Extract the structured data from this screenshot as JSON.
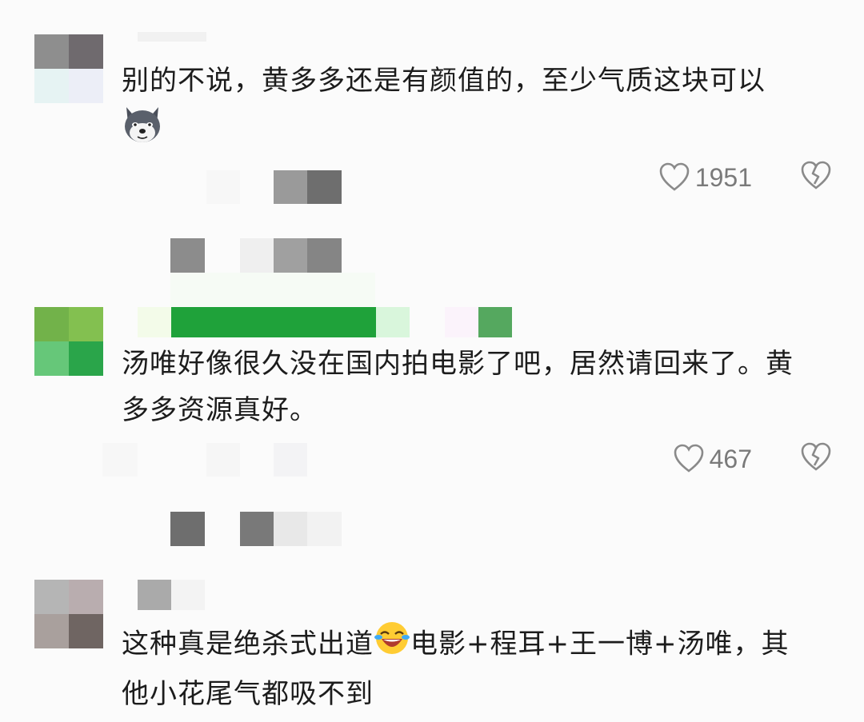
{
  "comments": [
    {
      "text": "别的不说，黄多多还是有颜值的，至少气质这块可以",
      "emoji": "wolf-face",
      "likes": "1951"
    },
    {
      "text_line1": "汤唯好像很久没在国内拍电影了吧，居然请回来了。黄",
      "text_line2": "多多资源真好。",
      "likes": "467"
    },
    {
      "text_part1": "这种真是绝杀式出道",
      "emoji": "laughing-crying-face",
      "text_part2": "电影+程耳+王一博+汤唯，其",
      "text_line2": "他小花尾气都吸不到"
    }
  ],
  "colors": {
    "background": "#fbfbfb",
    "text": "#1c1c1c",
    "count": "#7a7a7a",
    "icon": "#8a8a8a"
  }
}
